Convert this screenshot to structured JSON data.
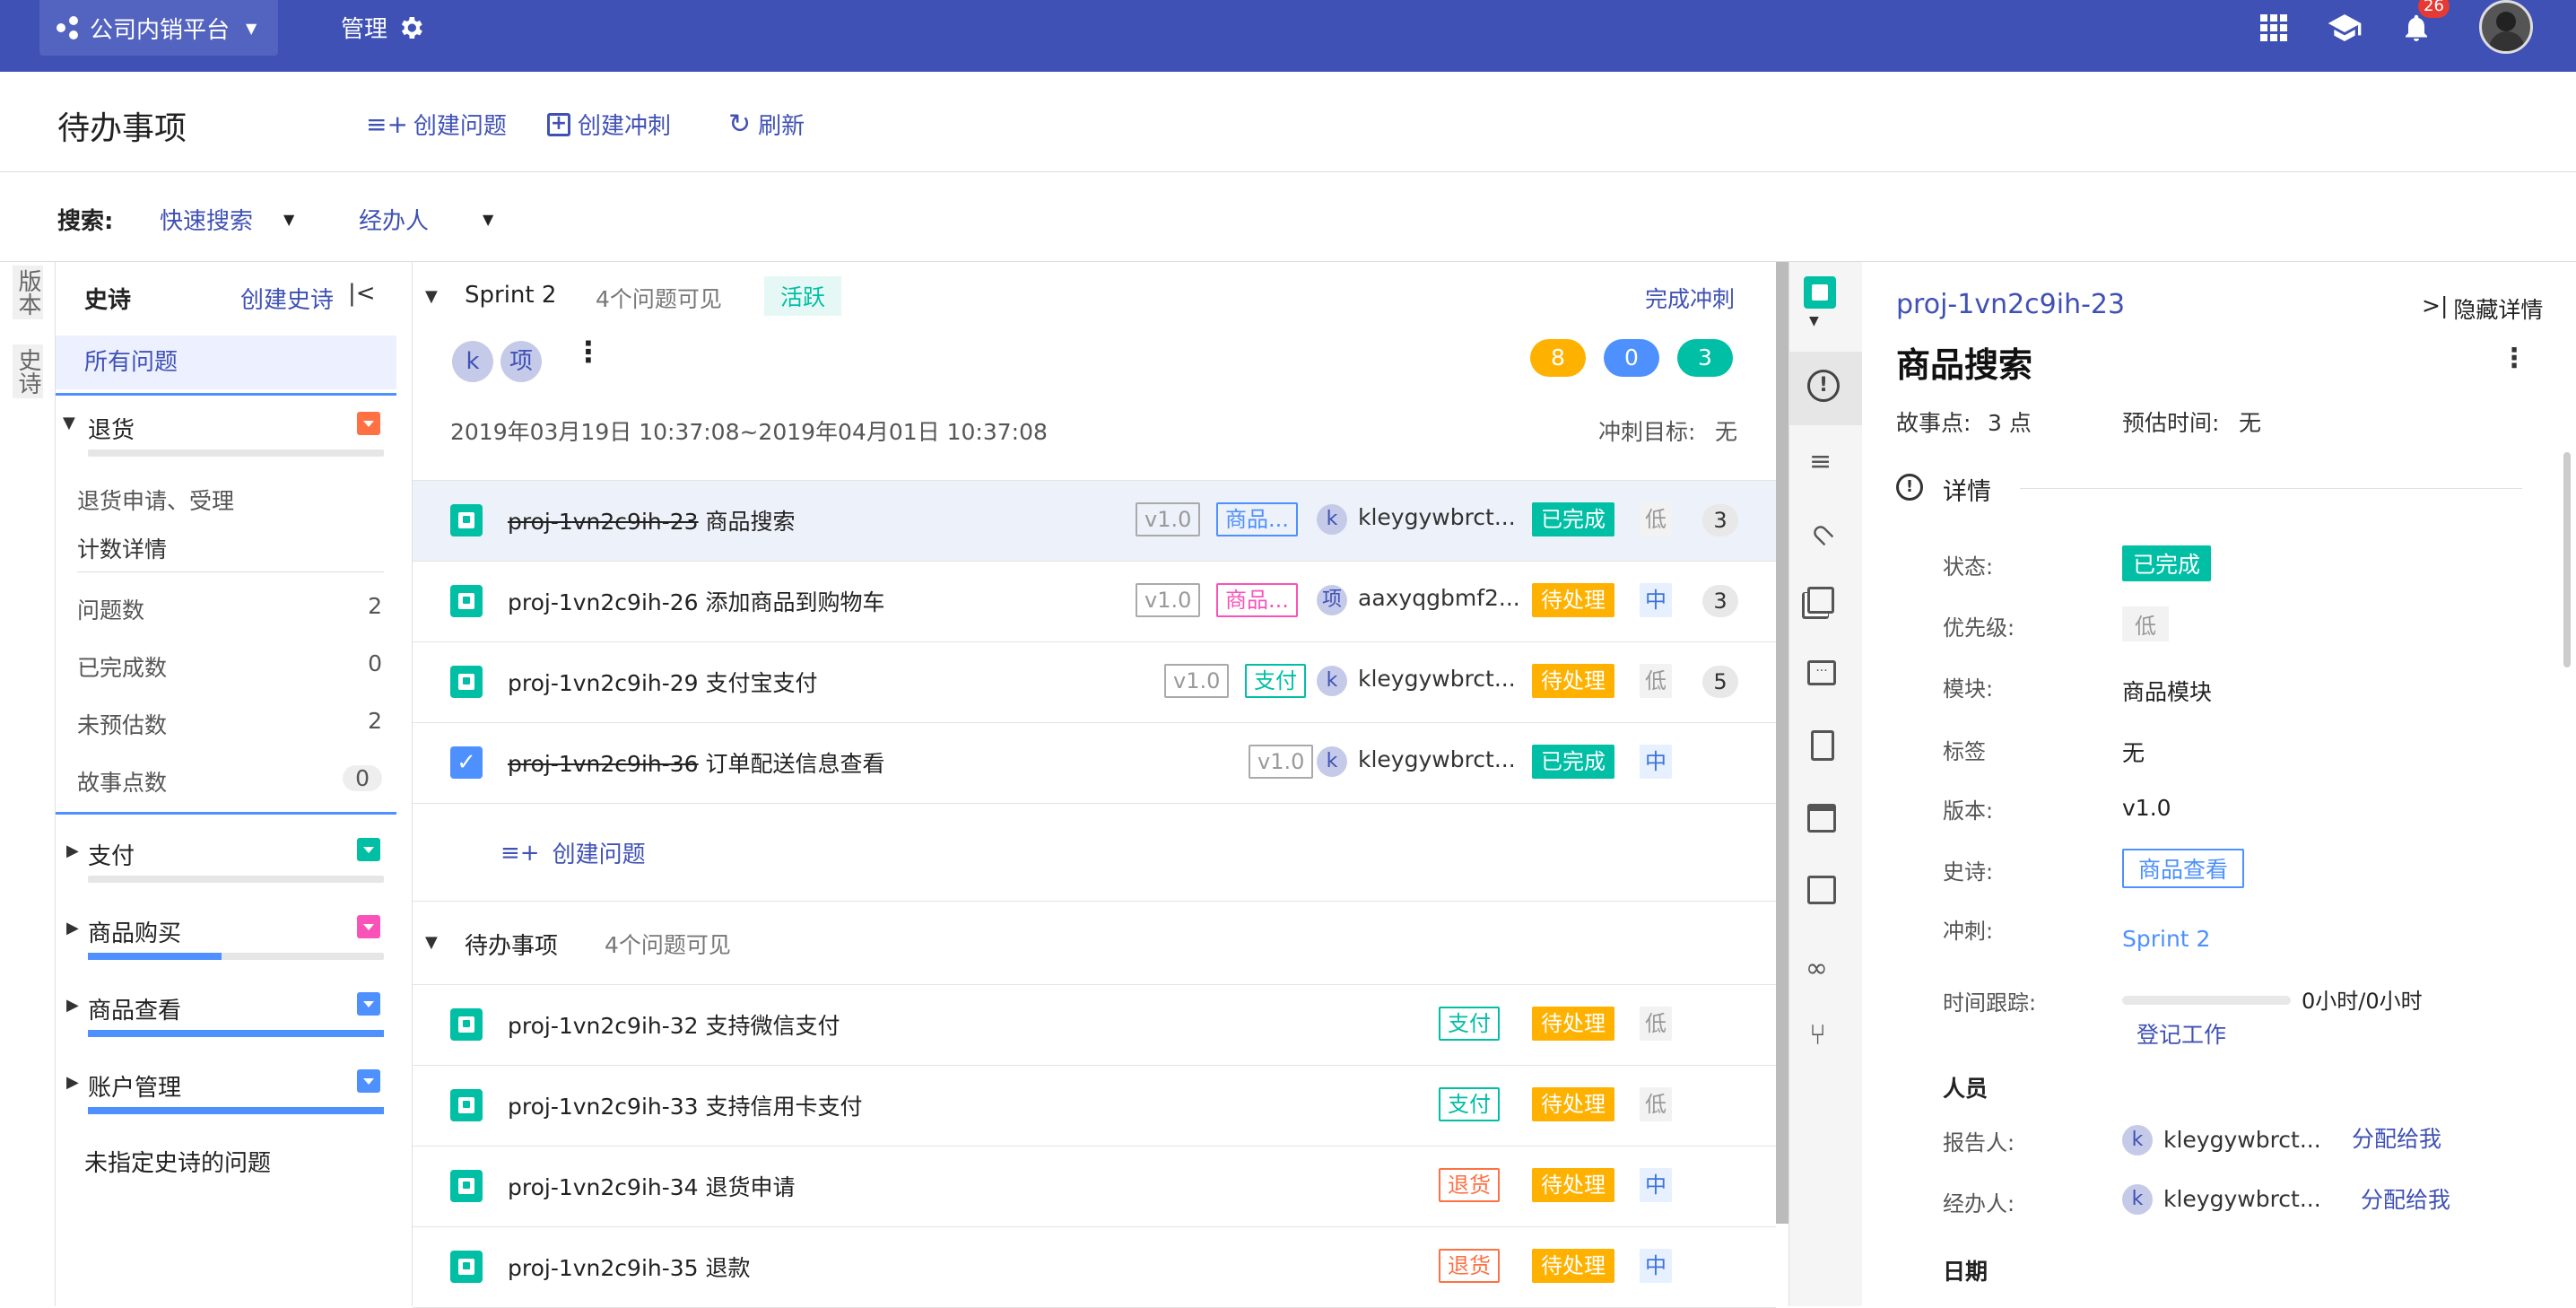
{
  "topbar": {
    "project_name": "公司内销平台",
    "manage_label": "管理",
    "notification_count": "26"
  },
  "header": {
    "title": "待办事项",
    "create_issue": "创建问题",
    "create_sprint": "创建冲刺",
    "refresh": "刷新"
  },
  "search": {
    "label": "搜索:",
    "quick_search": "快速搜索",
    "assignee": "经办人"
  },
  "left_strip": {
    "version": "版本",
    "epic": "史诗"
  },
  "epic_panel": {
    "title": "史诗",
    "create_epic": "创建史诗",
    "all_issues": "所有问题",
    "unassigned": "未指定史诗的问题",
    "epics": [
      {
        "name": "退货",
        "color": "#ff7043",
        "progress": 0.0
      },
      {
        "name": "支付",
        "color": "#00bfa5",
        "progress": 0.0
      },
      {
        "name": "商品购买",
        "color": "#f953ba",
        "progress": 0.45
      },
      {
        "name": "商品查看",
        "color": "#4d90fe",
        "progress": 1.0
      },
      {
        "name": "账户管理",
        "color": "#4d90fe",
        "progress": 1.0
      }
    ],
    "expanded": {
      "description": "退货申请、受理",
      "count_details": "计数详情",
      "stats": [
        {
          "label": "问题数",
          "value": "2"
        },
        {
          "label": "已完成数",
          "value": "0"
        },
        {
          "label": "未预估数",
          "value": "2"
        },
        {
          "label": "故事点数",
          "value": "0"
        }
      ]
    }
  },
  "sprint": {
    "name": "Sprint 2",
    "visible": "4个问题可见",
    "active": "活跃",
    "complete": "完成冲刺",
    "avatars": [
      "k",
      "项"
    ],
    "counts": [
      {
        "value": "8",
        "color": "#ffb100"
      },
      {
        "value": "0",
        "color": "#4d90fe"
      },
      {
        "value": "3",
        "color": "#00bfa5"
      }
    ],
    "date_range": "2019年03月19日 10:37:08~2019年04月01日 10:37:08",
    "goal_label": "冲刺目标:",
    "goal_value": "无",
    "create_issue": "创建问题",
    "issues": [
      {
        "key": "proj-1vn2c9ih-23",
        "summary": "商品搜索",
        "done": true,
        "version": "v1.0",
        "epic": "商品...",
        "epic_color": "#4d90fe",
        "avatar": "k",
        "assignee": "kleygywbrct...",
        "status": "已完成",
        "priority": "低",
        "points": "3"
      },
      {
        "key": "proj-1vn2c9ih-26",
        "summary": "添加商品到购物车",
        "done": false,
        "version": "v1.0",
        "epic": "商品...",
        "epic_color": "#f953ba",
        "avatar": "项",
        "assignee": "aaxyqgbmf2...",
        "status": "待处理",
        "priority": "中",
        "points": "3"
      },
      {
        "key": "proj-1vn2c9ih-29",
        "summary": "支付宝支付",
        "done": false,
        "version": "v1.0",
        "epic": "支付",
        "epic_color": "#00bfa5",
        "avatar": "k",
        "assignee": "kleygywbrct...",
        "status": "待处理",
        "priority": "低",
        "points": "5"
      },
      {
        "key": "proj-1vn2c9ih-36",
        "summary": "订单配送信息查看",
        "done": true,
        "version": "v1.0",
        "avatar": "k",
        "assignee": "kleygywbrct...",
        "status": "已完成",
        "priority": "中"
      }
    ]
  },
  "backlog": {
    "name": "待办事项",
    "visible": "4个问题可见",
    "issues": [
      {
        "key": "proj-1vn2c9ih-32",
        "summary": "支持微信支付",
        "epic": "支付",
        "epic_color": "#00bfa5",
        "status": "待处理",
        "priority": "低"
      },
      {
        "key": "proj-1vn2c9ih-33",
        "summary": "支持信用卡支付",
        "epic": "支付",
        "epic_color": "#00bfa5",
        "status": "待处理",
        "priority": "低"
      },
      {
        "key": "proj-1vn2c9ih-34",
        "summary": "退货申请",
        "epic": "退货",
        "epic_color": "#ff7043",
        "status": "待处理",
        "priority": "中"
      },
      {
        "key": "proj-1vn2c9ih-35",
        "summary": "退款",
        "epic": "退货",
        "epic_color": "#ff7043",
        "status": "待处理",
        "priority": "中"
      }
    ]
  },
  "detail": {
    "key": "proj-1vn2c9ih-23",
    "hide": "隐藏详情",
    "title": "商品搜索",
    "story_points_label": "故事点:",
    "story_points_value": "3 点",
    "estimate_label": "预估时间:",
    "estimate_value": "无",
    "section_details": "详情",
    "status_label": "状态:",
    "status_value": "已完成",
    "priority_label": "优先级:",
    "priority_value": "低",
    "module_label": "模块:",
    "module_value": "商品模块",
    "labels_label": "标签",
    "labels_value": "无",
    "version_label": "版本:",
    "version_value": "v1.0",
    "epic_label": "史诗:",
    "epic_value": "商品查看",
    "sprint_label": "冲刺:",
    "sprint_value": "Sprint 2",
    "time_label": "时间跟踪:",
    "time_value": "0小时/0小时",
    "log_work": "登记工作",
    "people": "人员",
    "reporter_label": "报告人:",
    "reporter_value": "kleygywbrct...",
    "assign_me": "分配给我",
    "assignee_label": "经办人:",
    "assignee_value": "kleygywbrct...",
    "dates": "日期"
  }
}
